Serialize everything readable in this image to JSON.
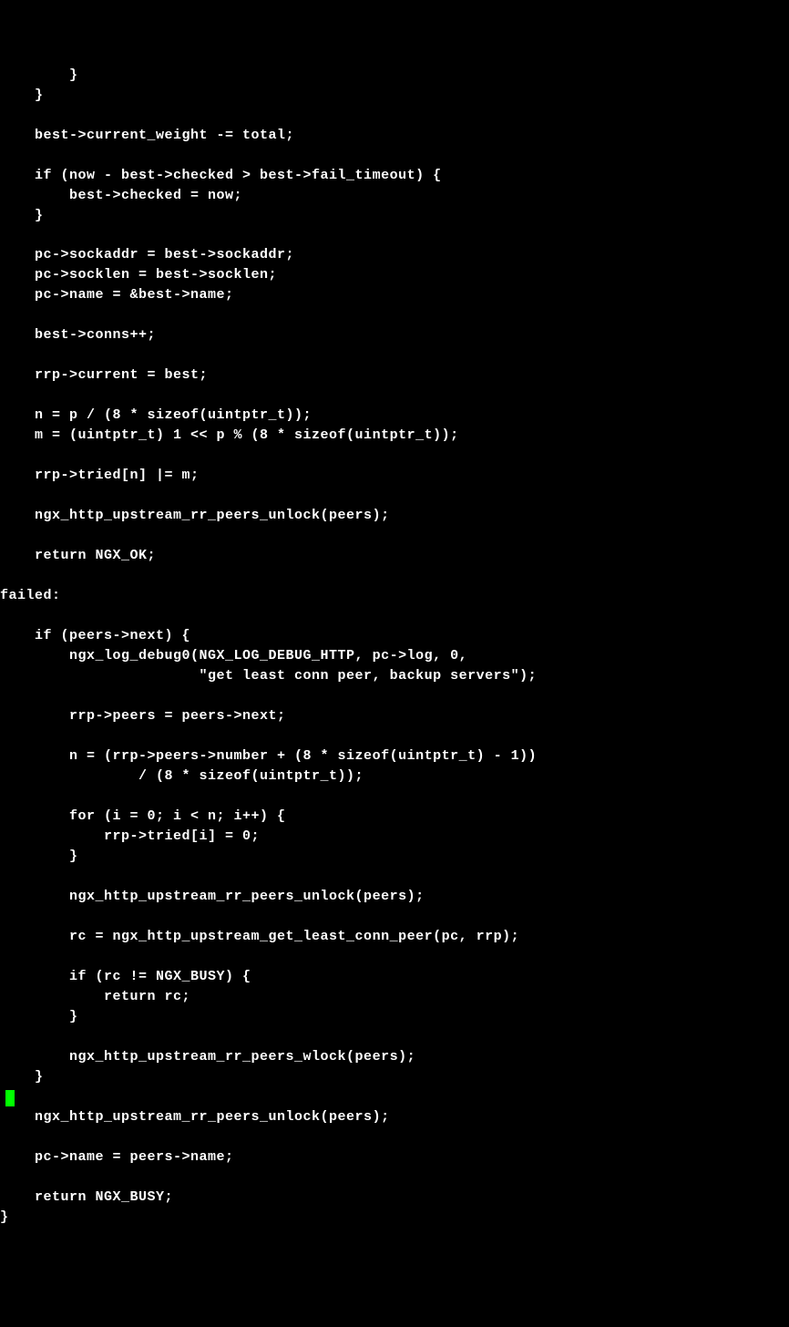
{
  "colors": {
    "background": "#000000",
    "foreground": "#ffffff",
    "cursor": "#00ff00"
  },
  "code": {
    "lines": [
      "        }",
      "    }",
      "",
      "    best->current_weight -= total;",
      "",
      "    if (now - best->checked > best->fail_timeout) {",
      "        best->checked = now;",
      "    }",
      "",
      "    pc->sockaddr = best->sockaddr;",
      "    pc->socklen = best->socklen;",
      "    pc->name = &best->name;",
      "",
      "    best->conns++;",
      "",
      "    rrp->current = best;",
      "",
      "    n = p / (8 * sizeof(uintptr_t));",
      "    m = (uintptr_t) 1 << p % (8 * sizeof(uintptr_t));",
      "",
      "    rrp->tried[n] |= m;",
      "",
      "    ngx_http_upstream_rr_peers_unlock(peers);",
      "",
      "    return NGX_OK;",
      "",
      "failed:",
      "",
      "    if (peers->next) {",
      "        ngx_log_debug0(NGX_LOG_DEBUG_HTTP, pc->log, 0,",
      "                       \"get least conn peer, backup servers\");",
      "",
      "        rrp->peers = peers->next;",
      "",
      "        n = (rrp->peers->number + (8 * sizeof(uintptr_t) - 1))",
      "                / (8 * sizeof(uintptr_t));",
      "",
      "        for (i = 0; i < n; i++) {",
      "            rrp->tried[i] = 0;",
      "        }",
      "",
      "        ngx_http_upstream_rr_peers_unlock(peers);",
      "",
      "        rc = ngx_http_upstream_get_least_conn_peer(pc, rrp);",
      "",
      "        if (rc != NGX_BUSY) {",
      "            return rc;",
      "        }",
      "",
      "        ngx_http_upstream_rr_peers_wlock(peers);",
      "    }",
      "",
      "    ngx_http_upstream_rr_peers_unlock(peers);",
      "",
      "    pc->name = peers->name;",
      "",
      "    return NGX_BUSY;",
      "}"
    ]
  }
}
